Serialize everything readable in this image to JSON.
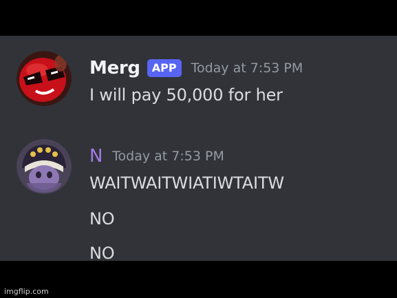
{
  "messages": [
    {
      "username": "Merg",
      "badge": "APP",
      "timestamp": "Today at 7:53 PM",
      "lines": [
        "I will pay 50,000 for her"
      ],
      "avatar_icon": "red-emoji-sunglasses-avatar"
    },
    {
      "username": "N",
      "timestamp": "Today at 7:53 PM",
      "lines": [
        "WAITWAITWIATIWTAITW",
        "NO",
        "NO"
      ],
      "avatar_icon": "purple-character-avatar"
    }
  ],
  "watermark": "imgflip.com",
  "colors": {
    "background": "#313338",
    "username": "#f2f3f5",
    "username_n": "#a17ae6",
    "app_badge": "#5865f2",
    "timestamp": "#949ba4",
    "message_text": "#dbdee1"
  }
}
